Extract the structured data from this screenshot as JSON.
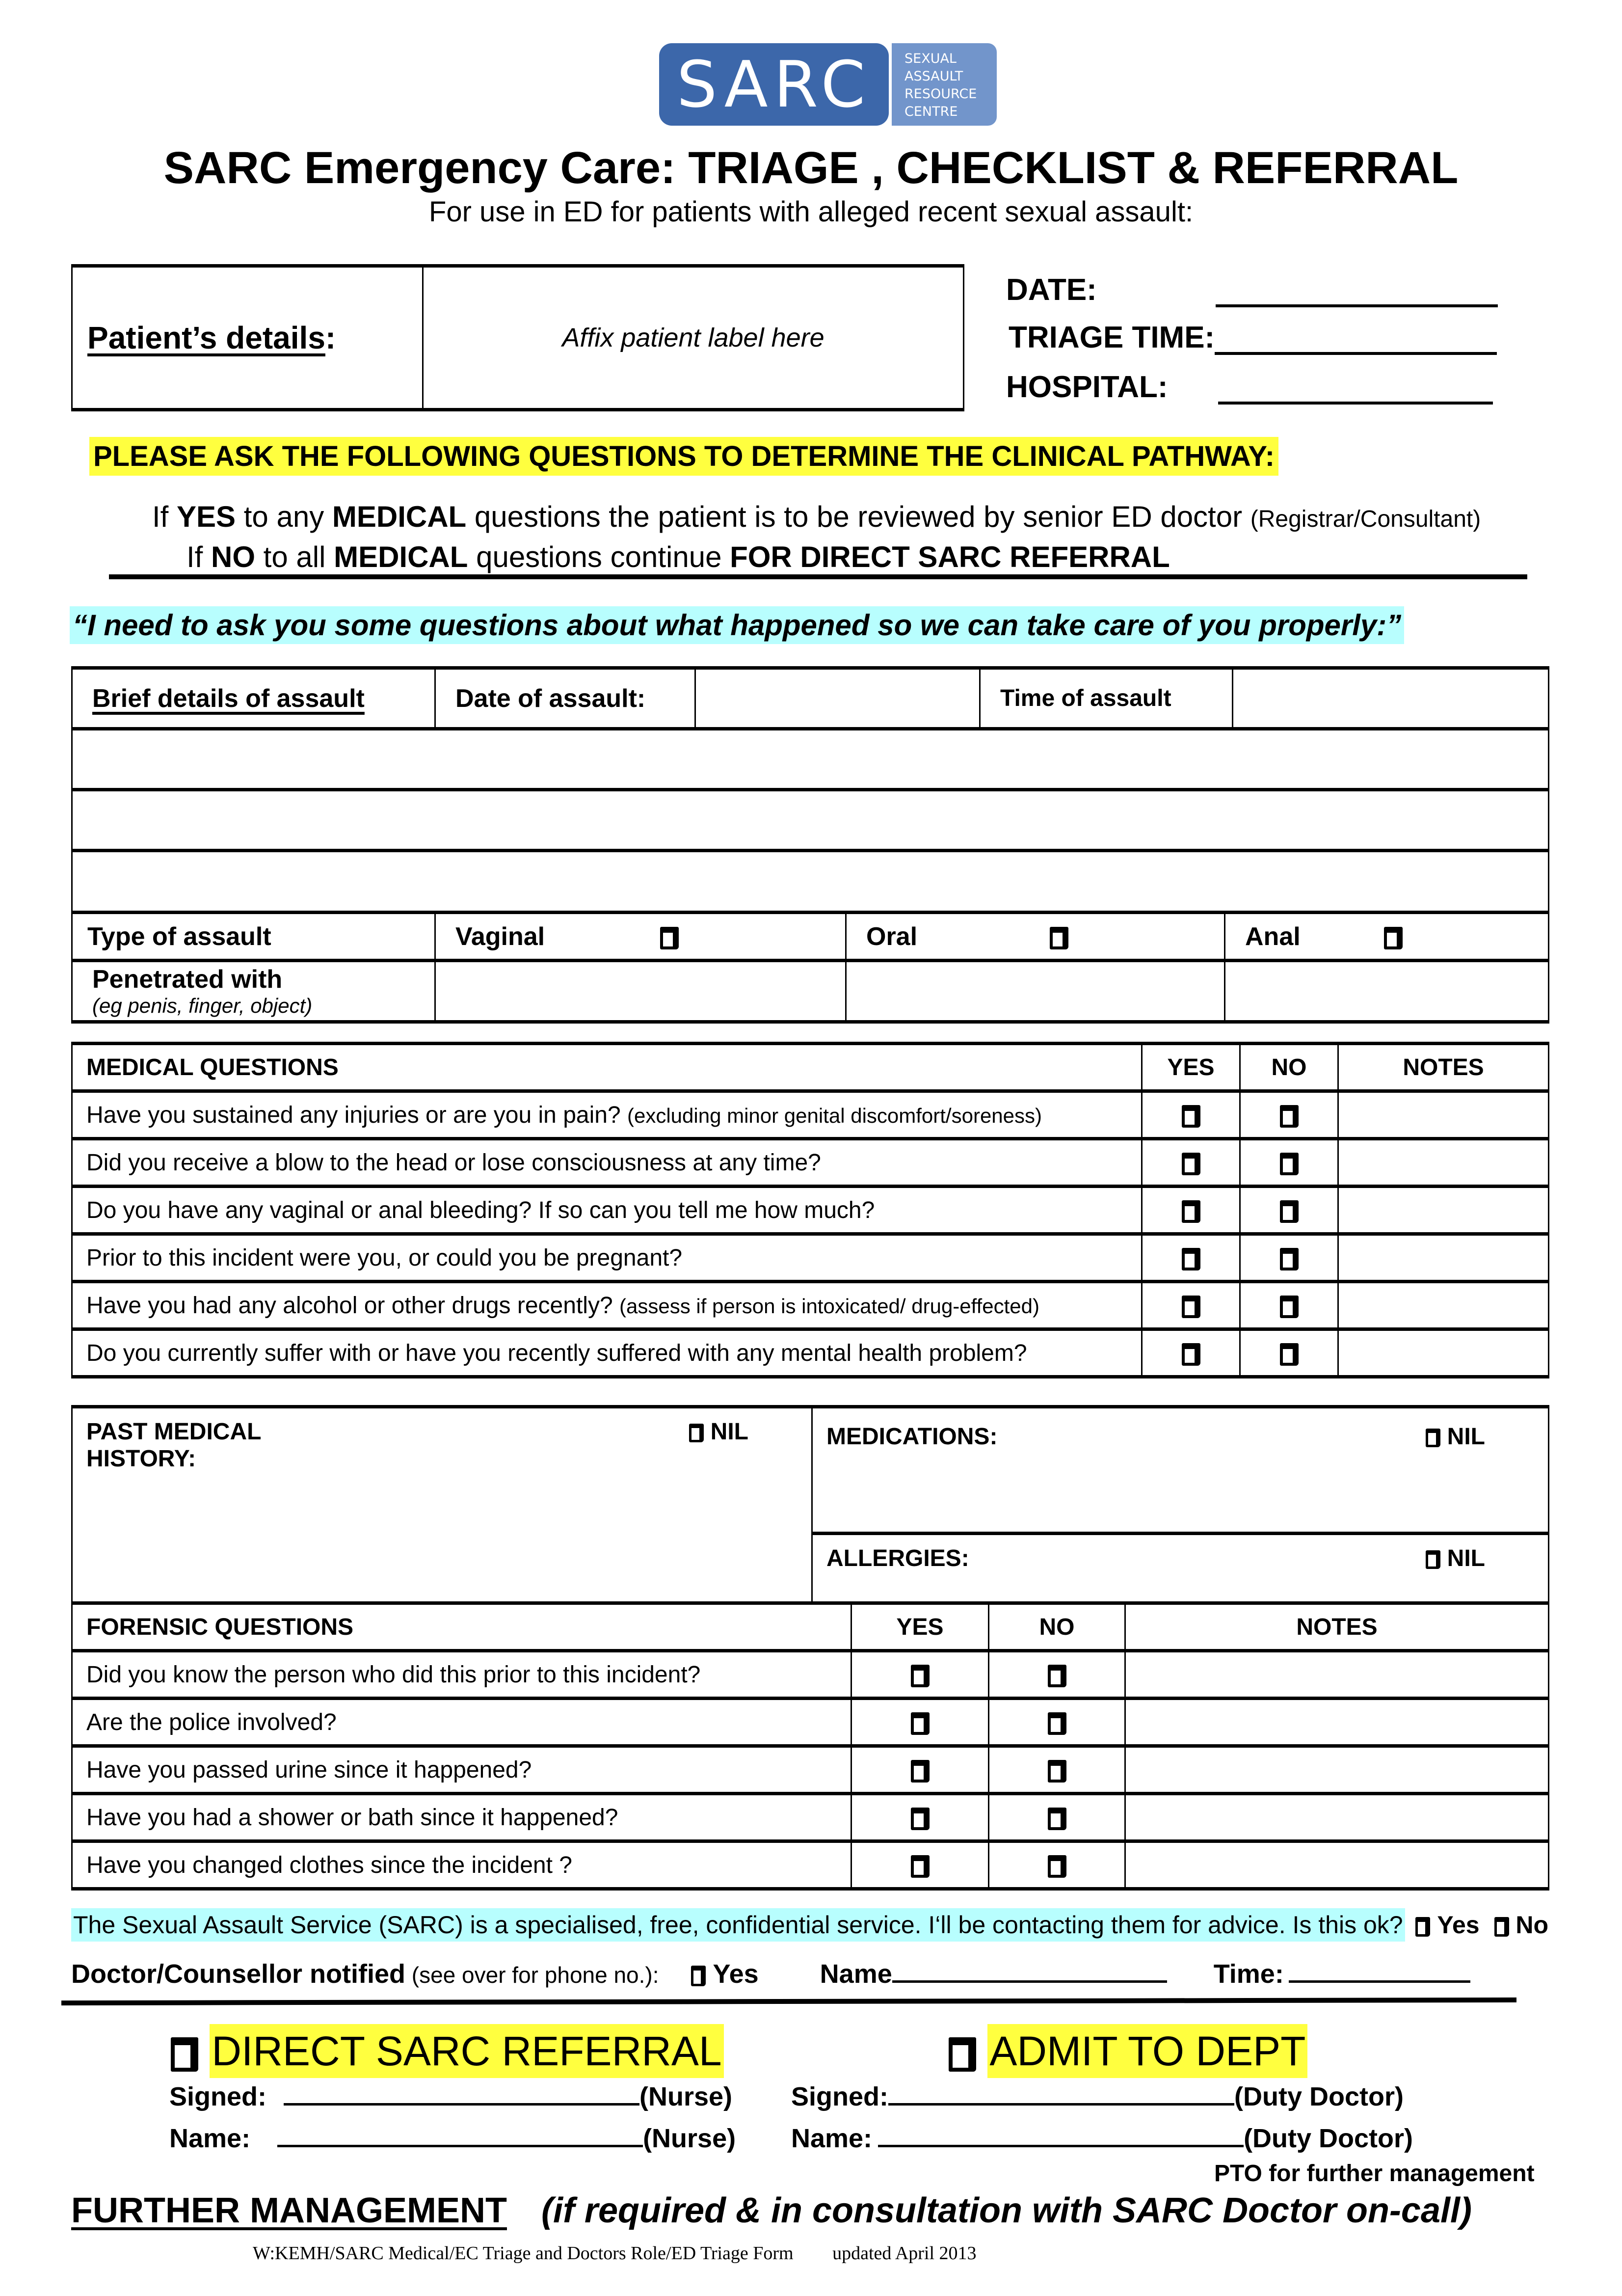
{
  "logo": {
    "main": "SARC",
    "side_lines": [
      "SEXUAL",
      "ASSAULT",
      "RESOURCE",
      "CENTRE"
    ],
    "colors": {
      "main": "#3c67aa",
      "side": "#7295cb"
    }
  },
  "header": {
    "title": "SARC Emergency Care: TRIAGE , CHECKLIST & REFERRAL",
    "subtitle": "For use in ED for patients with alleged recent sexual assault:"
  },
  "patient": {
    "label": "Patient’s details",
    "colon": ":",
    "affix": "Affix patient label here"
  },
  "meta": {
    "date_label": "DATE:",
    "triage_time_label": "TRIAGE TIME:",
    "hospital_label": "HOSPITAL:"
  },
  "pathway": {
    "heading": "PLEASE ASK THE FOLLOWING QUESTIONS TO DETERMINE THE  CLINICAL PATHWAY:",
    "rule_yes": {
      "p1": "If ",
      "b1": "YES",
      "p2": " to any ",
      "b2": "MEDICAL",
      "p3": " questions the patient is to be reviewed by senior ED doctor ",
      "small": "(Registrar/Consultant)"
    },
    "rule_no": {
      "p1": "If ",
      "b1": "NO",
      "p2": " to all ",
      "b2": "MEDICAL",
      "p3": " questions continue ",
      "b3": "FOR DIRECT SARC REFERRAL"
    },
    "quote": "“I need to ask you some questions about what happened so we can take care of you properly:”",
    "highlight_yellow": "#ffff3f",
    "highlight_cyan": "#b8fefe"
  },
  "assault": {
    "brief_label": "Brief details of assault",
    "date_label": "Date of assault:",
    "time_label": "Time of assault",
    "type_label": "Type of assault",
    "types": [
      "Vaginal",
      "Oral",
      "Anal"
    ],
    "penetrated_label": "Penetrated with",
    "penetrated_hint": "(eg penis, finger, object)"
  },
  "medical": {
    "header": "MEDICAL QUESTIONS",
    "yes": "YES",
    "no": "NO",
    "notes": "NOTES",
    "questions": [
      {
        "text": "Have you sustained any injuries or are you in pain? ",
        "note": "(excluding minor genital discomfort/soreness)"
      },
      {
        "text": "Did you receive a blow to the head or lose consciousness at any time?",
        "note": ""
      },
      {
        "text": "Do you have any vaginal or anal bleeding? If so can you tell me how much?",
        "note": ""
      },
      {
        "text": "Prior to this incident were you, or could you be pregnant?",
        "note": ""
      },
      {
        "text": "Have you had any alcohol or other drugs recently? ",
        "note": "(assess if person is intoxicated/ drug-effected)"
      },
      {
        "text": "Do you currently suffer with or have you recently suffered with any mental health problem?",
        "note": ""
      }
    ]
  },
  "history": {
    "pmh_label_1": "PAST MEDICAL",
    "pmh_label_2": "HISTORY:",
    "medications_label": "MEDICATIONS:",
    "allergies_label": "ALLERGIES:",
    "nil": "NIL"
  },
  "forensic": {
    "header": "FORENSIC QUESTIONS",
    "yes": "YES",
    "no": "NO",
    "notes": "NOTES",
    "questions": [
      "Did you know the person who did this prior to this incident?",
      "Are the police involved?",
      "Have you passed urine since it happened?",
      "Have you had a shower or bath since it happened?",
      "Have you changed clothes since the incident ?"
    ]
  },
  "consent": {
    "text": "The Sexual Assault Service (SARC) is a specialised, free, confidential service. I‘ll be contacting them for advice. Is this ok?",
    "yes": "Yes",
    "no": "No"
  },
  "notified": {
    "label": "Doctor/Counsellor notified",
    "hint": " (see over for phone no.):",
    "yes": "Yes",
    "name_label": "Name",
    "time_label": "Time:"
  },
  "decision": {
    "direct": "DIRECT SARC REFERRAL",
    "admit": "ADMIT TO DEPT",
    "signed_label": "Signed:",
    "name_label": "Name:",
    "nurse": "(Nurse)",
    "duty_doctor": "(Duty Doctor)",
    "pto": "PTO for further management"
  },
  "further": {
    "label": "FURTHER MANAGEMENT",
    "note": "(if required & in consultation with SARC Doctor on-call)"
  },
  "footer": {
    "path": "W:KEMH/SARC Medical/EC Triage and Doctors Role/ED Triage Form",
    "updated": "updated  April 2013"
  }
}
